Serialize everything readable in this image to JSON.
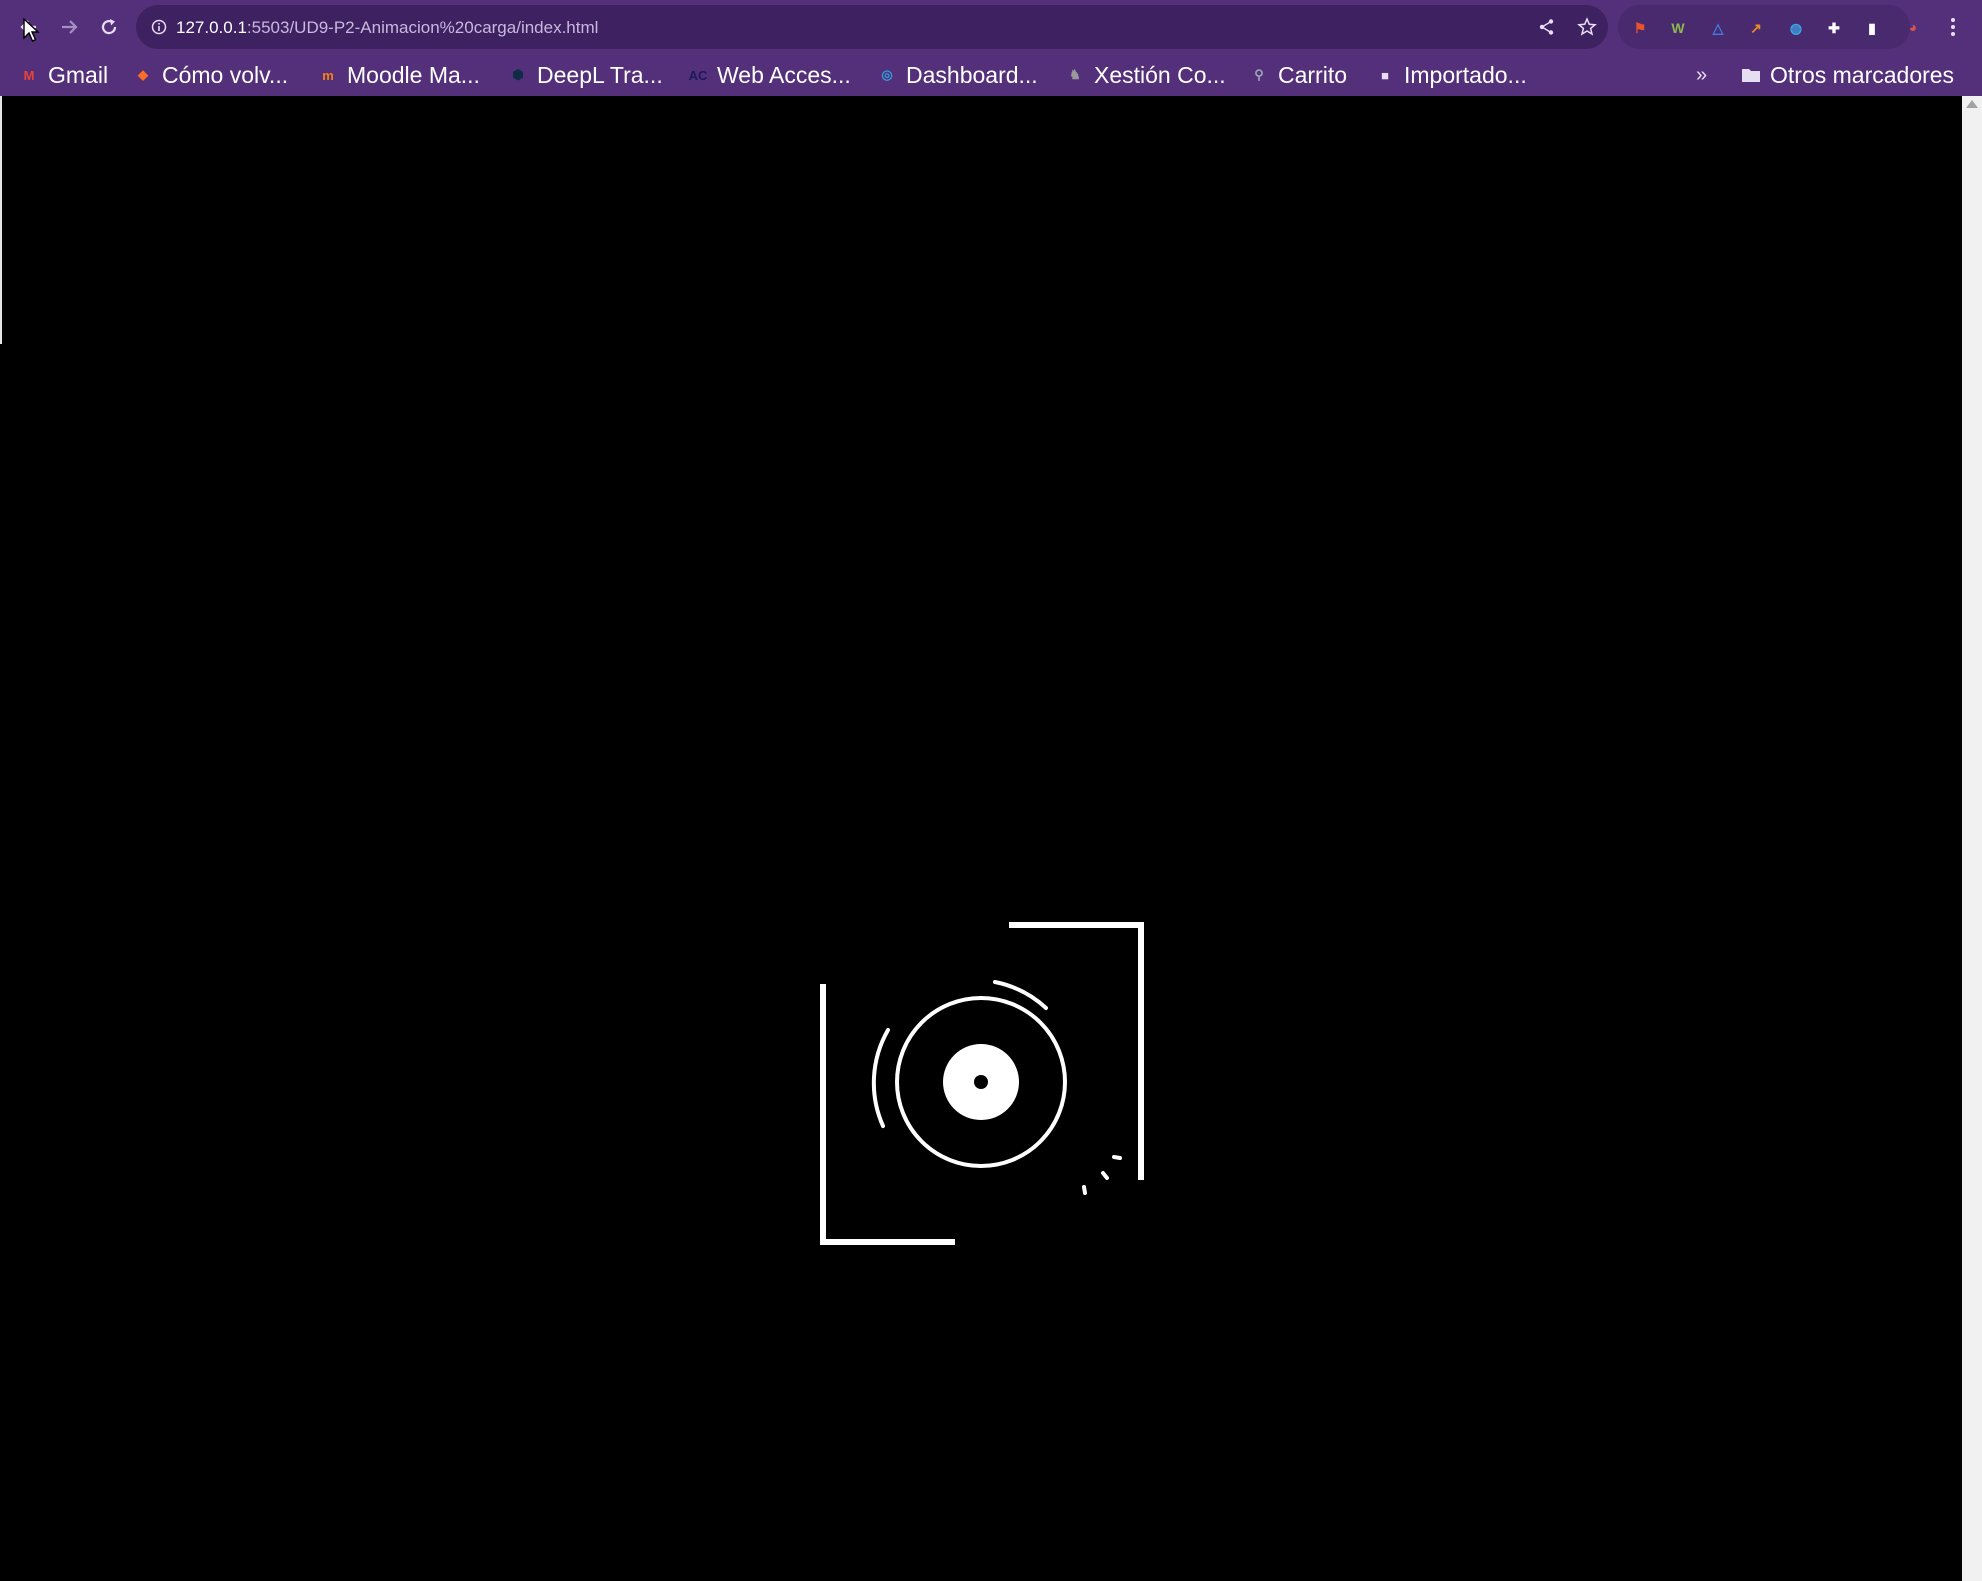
{
  "browser": {
    "url_host": "127.0.0.1",
    "url_path": ":5503/UD9-P2-Animacion%20carga/index.html",
    "nav": {
      "back_icon": "back-arrow-icon",
      "forward_icon": "forward-arrow-icon",
      "reload_icon": "reload-icon"
    },
    "omnibox_icons": [
      "info-icon",
      "share-icon",
      "star-icon"
    ],
    "extensions": [
      {
        "name": "extension-orange-icon",
        "glyph": "⚑",
        "color": "#e8552b"
      },
      {
        "name": "extension-w-icon",
        "glyph": "W",
        "color": "#8bb84a"
      },
      {
        "name": "extension-triangle-icon",
        "glyph": "△",
        "color": "#3f7be0"
      },
      {
        "name": "extension-chart-icon",
        "glyph": "↗",
        "color": "#f08a24"
      },
      {
        "name": "extension-globe-icon",
        "glyph": "◍",
        "color": "#3aa6e8"
      },
      {
        "name": "extensions-puzzle-icon",
        "glyph": "✚",
        "color": "#ffffff"
      },
      {
        "name": "side-panel-icon",
        "glyph": "▮",
        "color": "#ffffff"
      },
      {
        "name": "profile-avatar",
        "glyph": "◕",
        "color": "#d9534f"
      }
    ],
    "bookmarks": [
      {
        "label": "Gmail",
        "icon": "gmail-icon",
        "color": "#ea4335",
        "glyph": "M"
      },
      {
        "label": "Cómo volv...",
        "icon": "gitlab-icon",
        "color": "#fc6d26",
        "glyph": "◆"
      },
      {
        "label": "Moodle Ma...",
        "icon": "moodle-icon",
        "color": "#f98012",
        "glyph": "m"
      },
      {
        "label": "DeepL Tra...",
        "icon": "deepl-icon",
        "color": "#0f2b46",
        "glyph": "⬢"
      },
      {
        "label": "Web Acces...",
        "icon": "ac-icon",
        "color": "#1a1a5a",
        "glyph": "AC"
      },
      {
        "label": "Dashboard...",
        "icon": "dashboard-icon",
        "color": "#2d9cdb",
        "glyph": "◎"
      },
      {
        "label": "Xestión Co...",
        "icon": "xestion-icon",
        "color": "#999999",
        "glyph": "♞"
      },
      {
        "label": "Carrito",
        "icon": "carrito-icon",
        "color": "#9aa3b5",
        "glyph": "⚲"
      },
      {
        "label": "Importado...",
        "icon": "folder-icon",
        "color": "#e8def3",
        "glyph": "■"
      }
    ],
    "overflow_label": "»",
    "other_bookmarks": {
      "label": "Otros marcadores",
      "icon": "folder-icon"
    }
  },
  "page": {
    "background": "#000000",
    "loader_color": "#ffffff"
  }
}
